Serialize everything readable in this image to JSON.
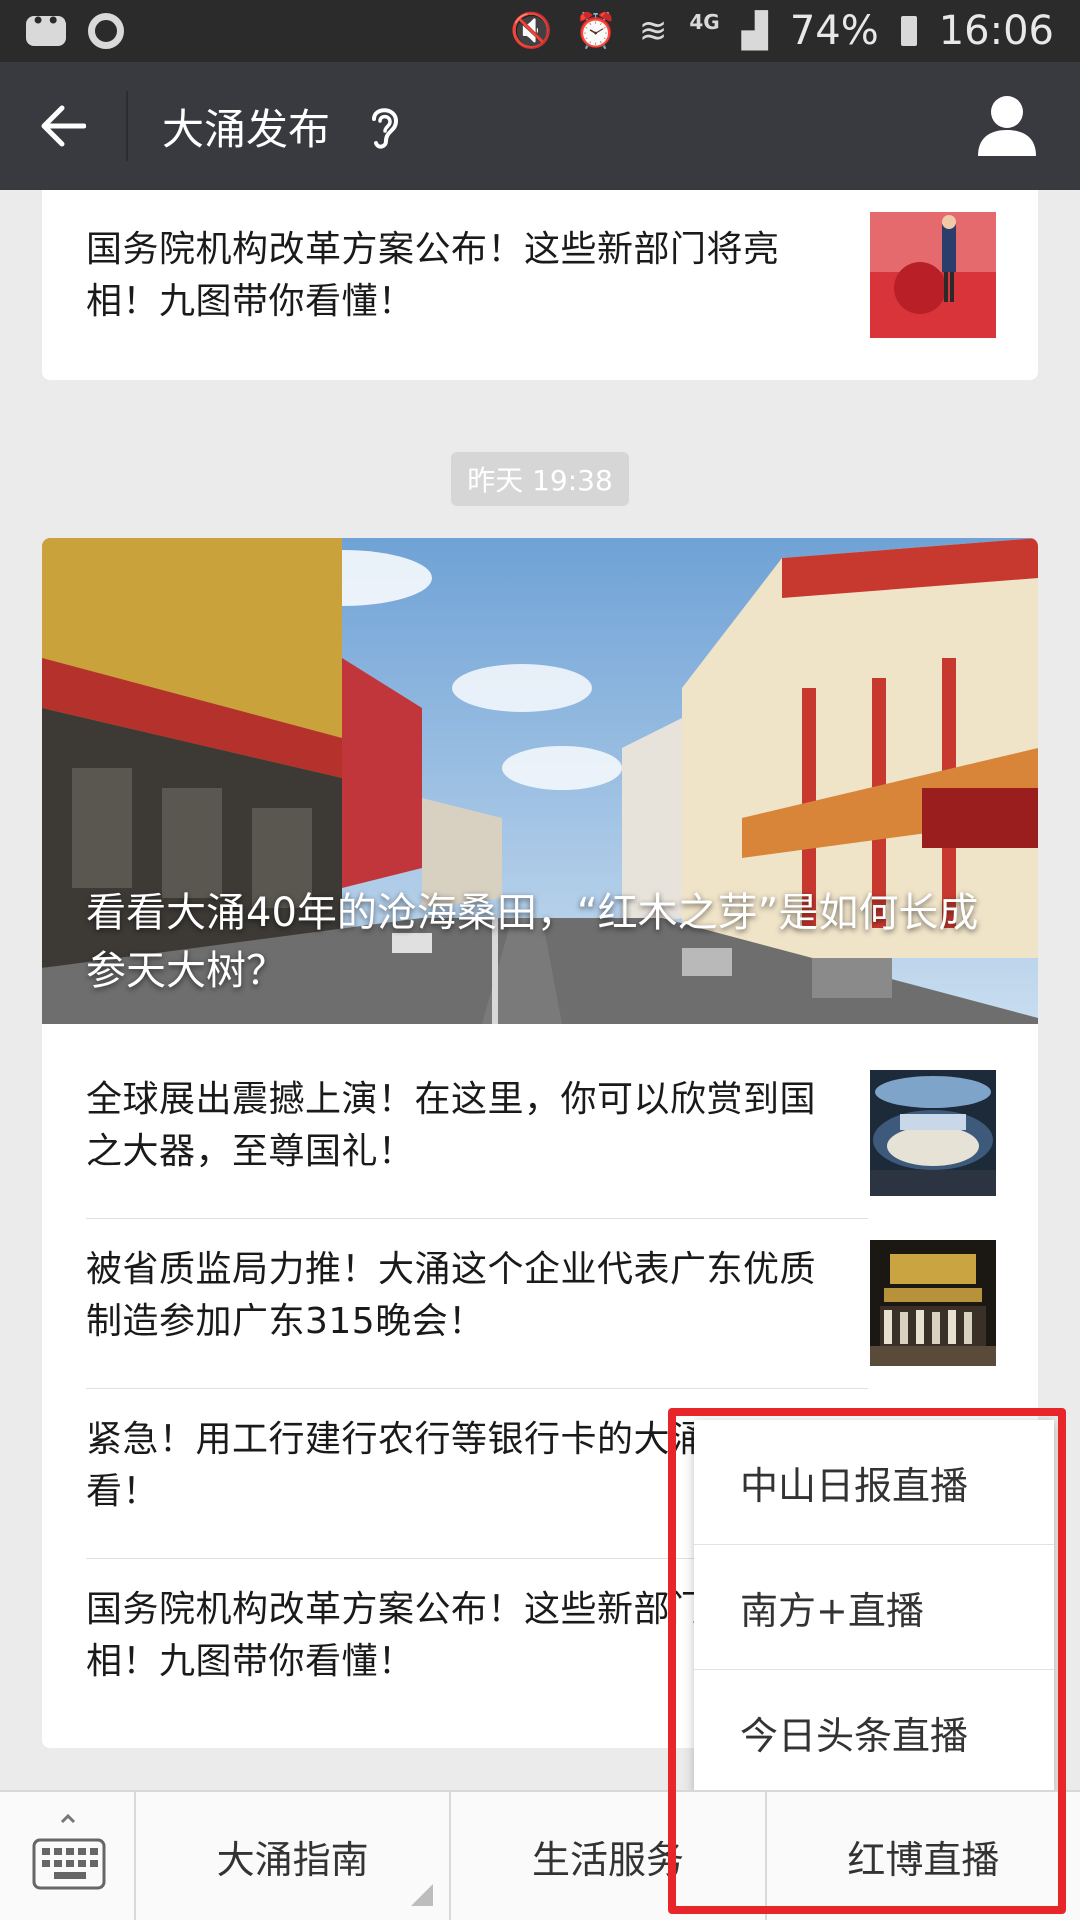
{
  "status_bar": {
    "battery": "74%",
    "time": "16:06",
    "network": "4G"
  },
  "nav": {
    "title": "大涌发布"
  },
  "top_article": {
    "title": "国务院机构改革方案公布！这些新部门将亮相！九图带你看懂！"
  },
  "timestamp": "昨天 19:38",
  "featured": {
    "hero_title": "看看大涌40年的沧海桑田，“红木之芽”是如何长成参天大树？",
    "items": [
      {
        "title": "全球展出震撼上演！在这里，你可以欣赏到国之大器，至尊国礼！",
        "thumb": "banquet-hall-image"
      },
      {
        "title": "被省质监局力推！大涌这个企业代表广东优质制造参加广东315晚会！",
        "thumb": "stage-event-image"
      },
      {
        "title": "紧急！用工行建行农行等银行卡的大涌人马上看！",
        "thumb": ""
      },
      {
        "title": "国务院机构改革方案公布！这些新部门将亮相！九图带你看懂！",
        "thumb": ""
      }
    ]
  },
  "popup_menu": {
    "items": [
      "中山日报直播",
      "南方+直播",
      "今日头条直播"
    ]
  },
  "bottom_menu": {
    "tabs": [
      "大涌指南",
      "生活服务",
      "红博直播"
    ]
  },
  "colors": {
    "status_bar": "#2b2b2b",
    "nav_bar": "#393a3f",
    "background": "#ebebeb",
    "highlight_box": "#e8262a"
  }
}
